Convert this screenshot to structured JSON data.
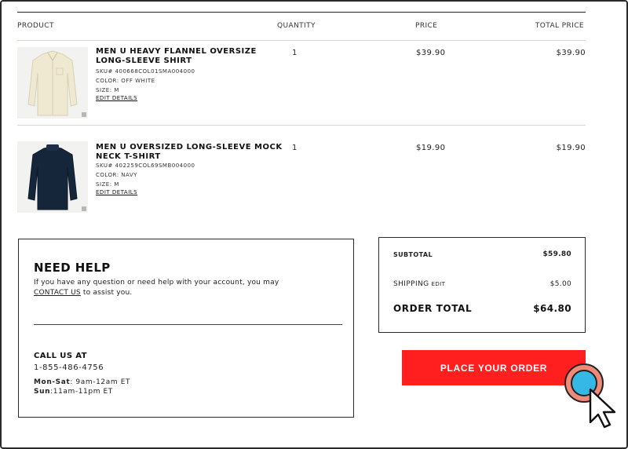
{
  "table": {
    "headers": {
      "product": "PRODUCT",
      "quantity": "QUANTITY",
      "price": "PRICE",
      "total": "TOTAL PRICE"
    },
    "items": [
      {
        "name": "MEN U HEAVY FLANNEL OVERSIZE LONG-SLEEVE SHIRT",
        "sku": "SKU# 400668COL01SMA004000",
        "color": "COLOR: OFF WHITE",
        "size": "SIZE: M",
        "edit": "EDIT DETAILS",
        "quantity": "1",
        "price": "$39.90",
        "total": "$39.90",
        "image_color": "#efe9d2"
      },
      {
        "name": "MEN U OVERSIZED LONG-SLEEVE MOCK NECK T-SHIRT",
        "sku": "SKU# 402259COL69SMB004000",
        "color": "COLOR: NAVY",
        "size": "SIZE: M",
        "edit": "EDIT DETAILS",
        "quantity": "1",
        "price": "$19.90",
        "total": "$19.90",
        "image_color": "#16263a"
      }
    ]
  },
  "help": {
    "title": "NEED HELP",
    "line1": "If you have any question or need help with your account, you may",
    "contact_link": "CONTACT US",
    "line2_rest": " to assist you.",
    "call_title": "CALL US AT",
    "phone": "1-855-486-4756",
    "hours": [
      {
        "days": "Mon-Sat",
        "time": ": 9am-12am  ET"
      },
      {
        "days": "Sun",
        "time": ":11am-11pm  ET"
      }
    ]
  },
  "summary": {
    "subtotal_label": "SUBTOTAL",
    "subtotal_value": "$59.80",
    "shipping_label": "SHIPPING",
    "shipping_edit": "EDIT",
    "shipping_value": "$5.00",
    "order_total_label": "ORDER TOTAL",
    "order_total_value": "$64.80"
  },
  "cta": {
    "place_order_label": "PLACE YOUR ORDER",
    "color": "#ff1f1f"
  },
  "icons": {
    "cursor": "pointer-cursor-icon",
    "click": "click-indicator-icon"
  }
}
